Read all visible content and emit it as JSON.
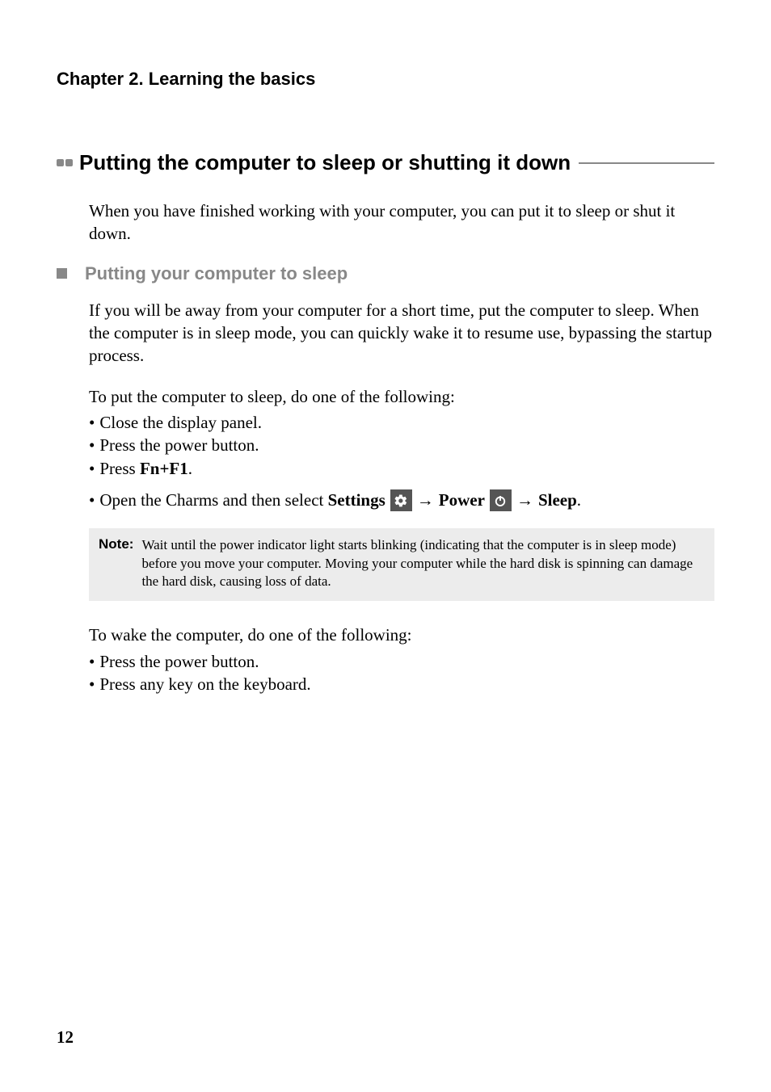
{
  "chapterHeader": "Chapter 2. Learning the basics",
  "mainHeading": "Putting the computer to sleep or shutting it down",
  "intro": "When you have finished working with your computer, you can put it to sleep or shut it down.",
  "subHeading": "Putting your computer to sleep",
  "para1": "If you will be away from your computer for a short time, put the computer to sleep. When the computer is in sleep mode, you can quickly wake it to resume use, bypassing the startup process.",
  "para2": "To put the computer to sleep, do one of the following:",
  "bullets1": {
    "b1": "Close the display panel.",
    "b2": "Press the power button.",
    "b3_pre": "Press ",
    "b3_bold": "Fn+F1",
    "b3_post": "."
  },
  "charms": {
    "pre": "Open the Charms and then select ",
    "settings": "Settings",
    "power": "Power",
    "sleep": "Sleep",
    "arrow": "→",
    "period": "."
  },
  "note": {
    "label": "Note:",
    "text": "Wait until the power indicator light starts blinking (indicating that the computer is in sleep mode) before you move your computer. Moving your computer while the hard disk is spinning can damage the hard disk, causing loss of data."
  },
  "para3": "To wake the computer, do one of the following:",
  "bullets2": {
    "b1": "Press the power button.",
    "b2": "Press any key on the keyboard."
  },
  "pageNumber": "12"
}
